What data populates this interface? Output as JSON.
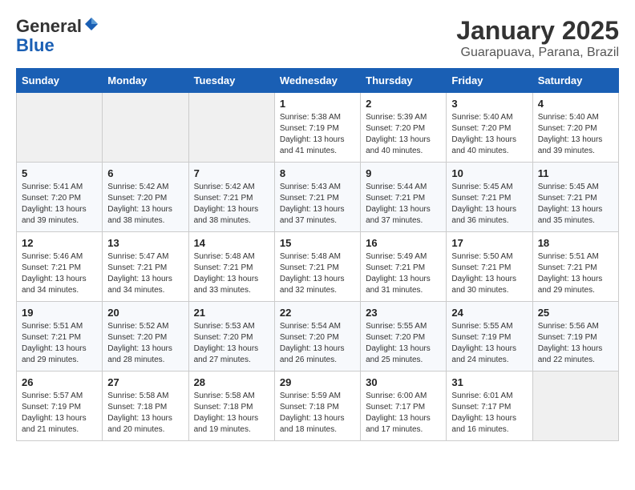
{
  "logo": {
    "general": "General",
    "blue": "Blue"
  },
  "header": {
    "title": "January 2025",
    "subtitle": "Guarapuava, Parana, Brazil"
  },
  "weekdays": [
    "Sunday",
    "Monday",
    "Tuesday",
    "Wednesday",
    "Thursday",
    "Friday",
    "Saturday"
  ],
  "weeks": [
    [
      {
        "day": "",
        "info": ""
      },
      {
        "day": "",
        "info": ""
      },
      {
        "day": "",
        "info": ""
      },
      {
        "day": "1",
        "info": "Sunrise: 5:38 AM\nSunset: 7:19 PM\nDaylight: 13 hours and 41 minutes."
      },
      {
        "day": "2",
        "info": "Sunrise: 5:39 AM\nSunset: 7:20 PM\nDaylight: 13 hours and 40 minutes."
      },
      {
        "day": "3",
        "info": "Sunrise: 5:40 AM\nSunset: 7:20 PM\nDaylight: 13 hours and 40 minutes."
      },
      {
        "day": "4",
        "info": "Sunrise: 5:40 AM\nSunset: 7:20 PM\nDaylight: 13 hours and 39 minutes."
      }
    ],
    [
      {
        "day": "5",
        "info": "Sunrise: 5:41 AM\nSunset: 7:20 PM\nDaylight: 13 hours and 39 minutes."
      },
      {
        "day": "6",
        "info": "Sunrise: 5:42 AM\nSunset: 7:20 PM\nDaylight: 13 hours and 38 minutes."
      },
      {
        "day": "7",
        "info": "Sunrise: 5:42 AM\nSunset: 7:21 PM\nDaylight: 13 hours and 38 minutes."
      },
      {
        "day": "8",
        "info": "Sunrise: 5:43 AM\nSunset: 7:21 PM\nDaylight: 13 hours and 37 minutes."
      },
      {
        "day": "9",
        "info": "Sunrise: 5:44 AM\nSunset: 7:21 PM\nDaylight: 13 hours and 37 minutes."
      },
      {
        "day": "10",
        "info": "Sunrise: 5:45 AM\nSunset: 7:21 PM\nDaylight: 13 hours and 36 minutes."
      },
      {
        "day": "11",
        "info": "Sunrise: 5:45 AM\nSunset: 7:21 PM\nDaylight: 13 hours and 35 minutes."
      }
    ],
    [
      {
        "day": "12",
        "info": "Sunrise: 5:46 AM\nSunset: 7:21 PM\nDaylight: 13 hours and 34 minutes."
      },
      {
        "day": "13",
        "info": "Sunrise: 5:47 AM\nSunset: 7:21 PM\nDaylight: 13 hours and 34 minutes."
      },
      {
        "day": "14",
        "info": "Sunrise: 5:48 AM\nSunset: 7:21 PM\nDaylight: 13 hours and 33 minutes."
      },
      {
        "day": "15",
        "info": "Sunrise: 5:48 AM\nSunset: 7:21 PM\nDaylight: 13 hours and 32 minutes."
      },
      {
        "day": "16",
        "info": "Sunrise: 5:49 AM\nSunset: 7:21 PM\nDaylight: 13 hours and 31 minutes."
      },
      {
        "day": "17",
        "info": "Sunrise: 5:50 AM\nSunset: 7:21 PM\nDaylight: 13 hours and 30 minutes."
      },
      {
        "day": "18",
        "info": "Sunrise: 5:51 AM\nSunset: 7:21 PM\nDaylight: 13 hours and 29 minutes."
      }
    ],
    [
      {
        "day": "19",
        "info": "Sunrise: 5:51 AM\nSunset: 7:21 PM\nDaylight: 13 hours and 29 minutes."
      },
      {
        "day": "20",
        "info": "Sunrise: 5:52 AM\nSunset: 7:20 PM\nDaylight: 13 hours and 28 minutes."
      },
      {
        "day": "21",
        "info": "Sunrise: 5:53 AM\nSunset: 7:20 PM\nDaylight: 13 hours and 27 minutes."
      },
      {
        "day": "22",
        "info": "Sunrise: 5:54 AM\nSunset: 7:20 PM\nDaylight: 13 hours and 26 minutes."
      },
      {
        "day": "23",
        "info": "Sunrise: 5:55 AM\nSunset: 7:20 PM\nDaylight: 13 hours and 25 minutes."
      },
      {
        "day": "24",
        "info": "Sunrise: 5:55 AM\nSunset: 7:19 PM\nDaylight: 13 hours and 24 minutes."
      },
      {
        "day": "25",
        "info": "Sunrise: 5:56 AM\nSunset: 7:19 PM\nDaylight: 13 hours and 22 minutes."
      }
    ],
    [
      {
        "day": "26",
        "info": "Sunrise: 5:57 AM\nSunset: 7:19 PM\nDaylight: 13 hours and 21 minutes."
      },
      {
        "day": "27",
        "info": "Sunrise: 5:58 AM\nSunset: 7:18 PM\nDaylight: 13 hours and 20 minutes."
      },
      {
        "day": "28",
        "info": "Sunrise: 5:58 AM\nSunset: 7:18 PM\nDaylight: 13 hours and 19 minutes."
      },
      {
        "day": "29",
        "info": "Sunrise: 5:59 AM\nSunset: 7:18 PM\nDaylight: 13 hours and 18 minutes."
      },
      {
        "day": "30",
        "info": "Sunrise: 6:00 AM\nSunset: 7:17 PM\nDaylight: 13 hours and 17 minutes."
      },
      {
        "day": "31",
        "info": "Sunrise: 6:01 AM\nSunset: 7:17 PM\nDaylight: 13 hours and 16 minutes."
      },
      {
        "day": "",
        "info": ""
      }
    ]
  ]
}
